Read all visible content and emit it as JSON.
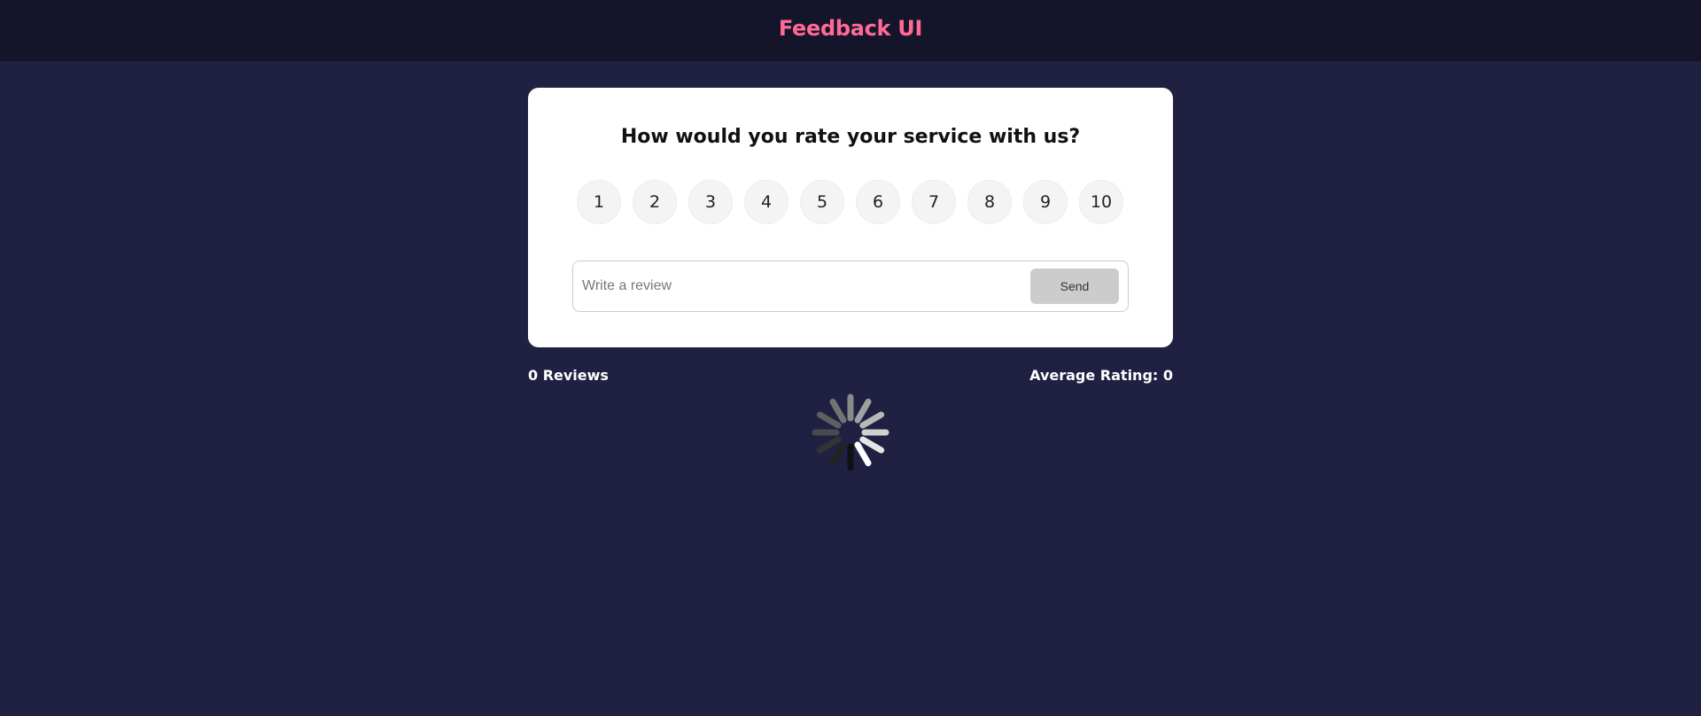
{
  "header": {
    "title": "Feedback UI"
  },
  "card": {
    "question": "How would you rate your service with us?",
    "ratings": [
      "1",
      "2",
      "3",
      "4",
      "5",
      "6",
      "7",
      "8",
      "9",
      "10"
    ],
    "review_placeholder": "Write a review",
    "review_value": "",
    "send_label": "Send"
  },
  "stats": {
    "reviews": "0 Reviews",
    "average": "Average Rating: 0"
  },
  "spinner": {
    "icon": "loading-spinner-icon"
  },
  "colors": {
    "background": "#202142",
    "header": "#14152a",
    "brand": "#ff6a95",
    "card": "#ffffff",
    "send_disabled": "#cccccc"
  }
}
